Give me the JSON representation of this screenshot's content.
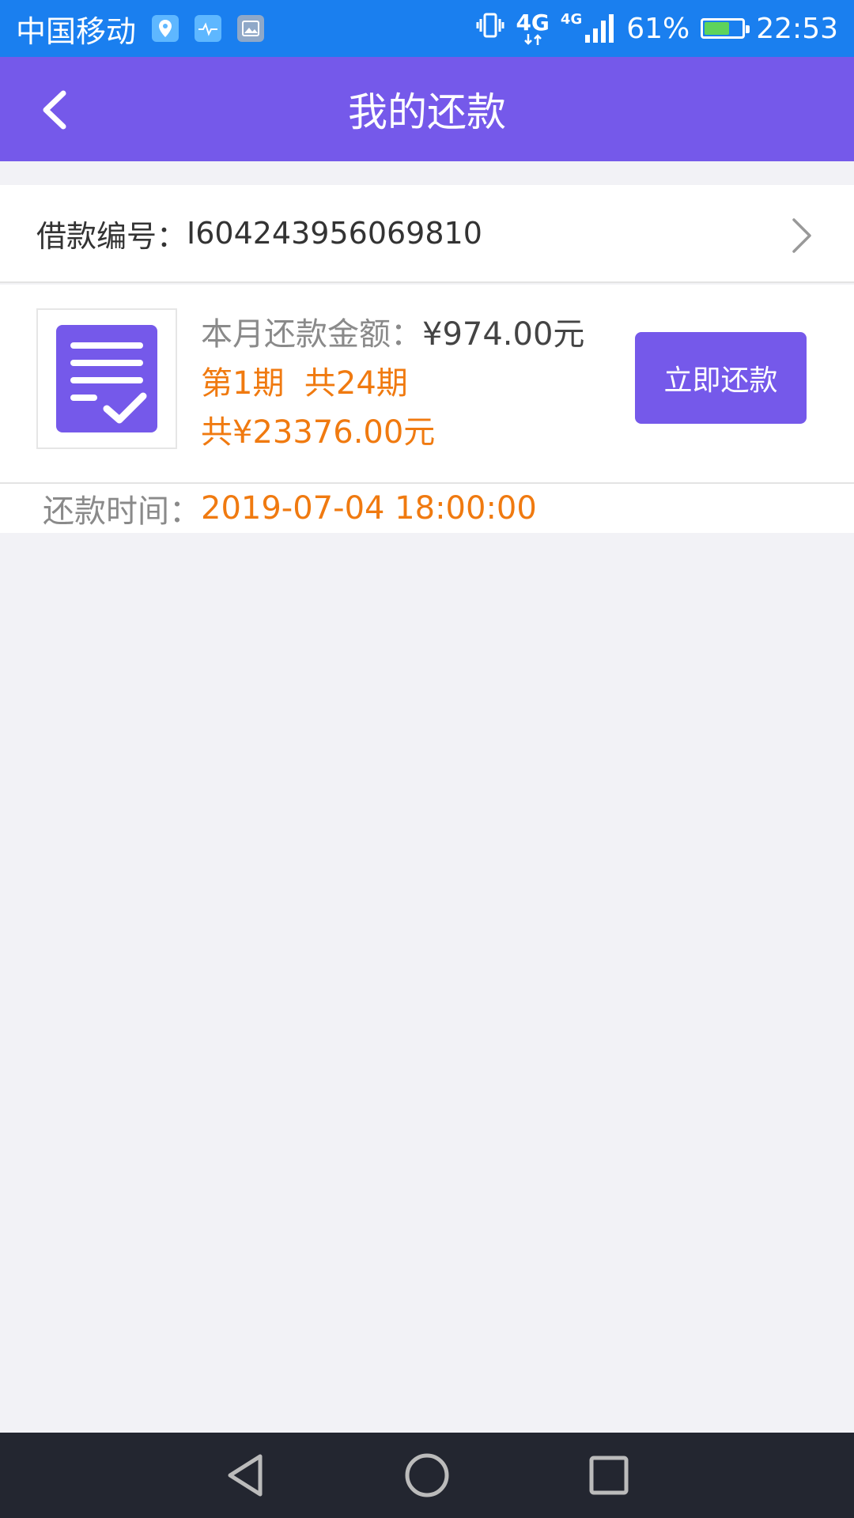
{
  "status_bar": {
    "carrier": "中国移动",
    "network_a": "4G",
    "network_b": "4G",
    "battery_percent": "61%",
    "battery_level": 0.61,
    "time": "22:53"
  },
  "header": {
    "title": "我的还款"
  },
  "loan": {
    "label": "借款编号：",
    "number": "I604243956069810"
  },
  "repayment": {
    "monthly_label": "本月还款金额：",
    "monthly_amount": "¥974.00元",
    "period_current": "第1期",
    "period_total": "共24期",
    "total_amount": "共¥23376.00元",
    "pay_button": "立即还款",
    "time_label": "还款时间：",
    "time_value": "2019-07-04 18:00:00"
  },
  "colors": {
    "accent": "#7559ea",
    "status_bar": "#1a7fef",
    "highlight": "#f07a10"
  }
}
